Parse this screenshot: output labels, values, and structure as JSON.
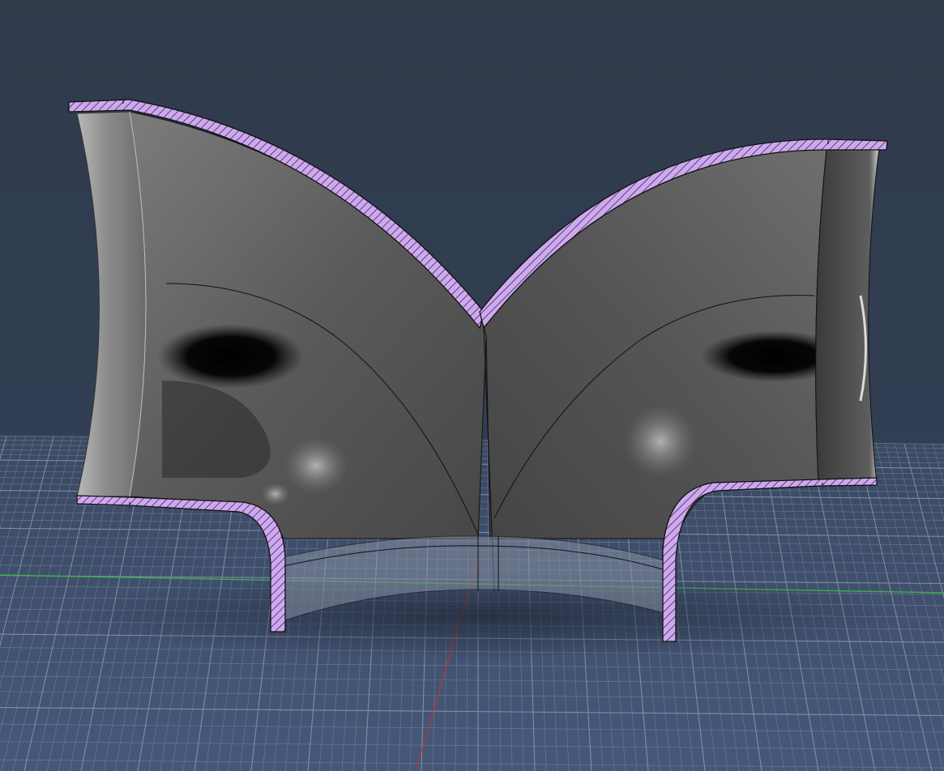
{
  "viewport": {
    "background_top_color": "#2f3a4b",
    "background_bottom_color": "#3e4d63",
    "grid_color": "#8494ae",
    "grid_major_color": "#a6b3c8",
    "x_axis_color": "#3fb04a",
    "y_axis_color": "#c0352c"
  },
  "model": {
    "section_hatch_color": "#c9a6ec",
    "section_outline_color": "#111111",
    "surface_shading": "metallic-gray",
    "view": "section-view"
  }
}
